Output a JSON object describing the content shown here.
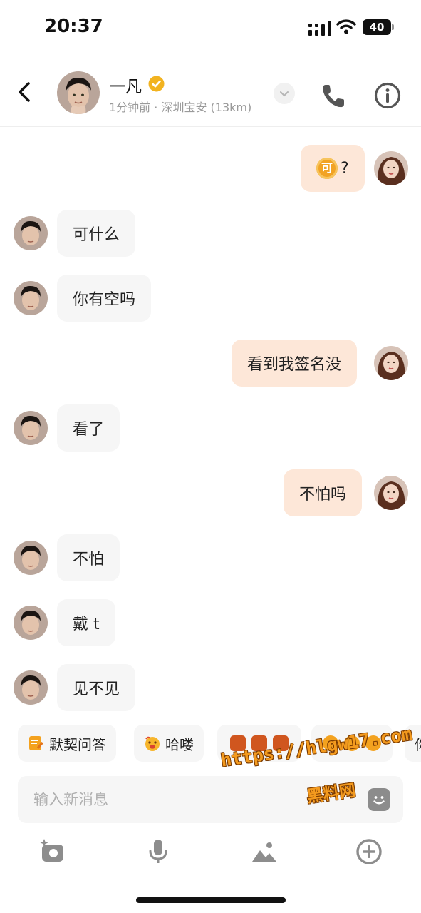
{
  "status_bar": {
    "time": "20:37",
    "battery": "40"
  },
  "header": {
    "contact_name": "一凡",
    "subline": "1分钟前 · 深圳宝安 (13km)",
    "colors": {
      "verified": "#f2b320"
    }
  },
  "messages": [
    {
      "dir": "out",
      "text": "?",
      "prefix_icon": "coin-icon",
      "coin_text": "可"
    },
    {
      "dir": "in",
      "text": "可什么"
    },
    {
      "dir": "in",
      "text": "你有空吗"
    },
    {
      "dir": "out",
      "text": "看到我签名没"
    },
    {
      "dir": "in",
      "text": "看了"
    },
    {
      "dir": "out",
      "text": "不怕吗"
    },
    {
      "dir": "in",
      "text": "不怕"
    },
    {
      "dir": "in",
      "text": "戴 t"
    },
    {
      "dir": "in",
      "text": "见不见"
    }
  ],
  "quick_replies": [
    {
      "label": "默契问答",
      "icon": "quiz-icon"
    },
    {
      "label": "哈喽",
      "icon": "hello-emoji-icon"
    },
    {
      "label": "",
      "icon": "door-emoji-icon"
    },
    {
      "label": "",
      "icon": "hug-emoji-icon"
    },
    {
      "label": "你",
      "icon": ""
    }
  ],
  "composer": {
    "placeholder": "输入新消息"
  },
  "watermark": {
    "line1": "https://hlgw17.com",
    "line2": "黑料网"
  },
  "colors": {
    "incoming_bubble": "#f6f6f6",
    "outgoing_bubble": "#fde7d8",
    "accent": "#f39a1e"
  }
}
